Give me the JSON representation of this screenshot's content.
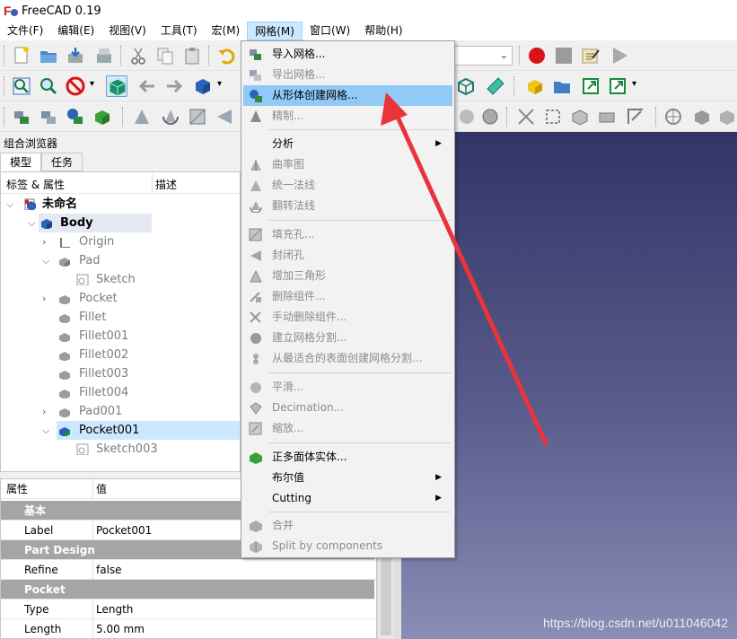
{
  "window": {
    "title": "FreeCAD 0.19"
  },
  "menubar": [
    {
      "label": "文件(F)"
    },
    {
      "label": "编辑(E)"
    },
    {
      "label": "视图(V)"
    },
    {
      "label": "工具(T)"
    },
    {
      "label": "宏(M)"
    },
    {
      "label": "网格(M)"
    },
    {
      "label": "窗口(W)"
    },
    {
      "label": "帮助(H)"
    }
  ],
  "combo_view": {
    "title": "组合浏览器",
    "tabs": [
      "模型",
      "任务"
    ],
    "tree_headers": {
      "label": "标签 & 属性",
      "desc": "描述"
    },
    "tree": [
      {
        "label": "未命名"
      },
      {
        "label": "Body"
      },
      {
        "label": "Origin"
      },
      {
        "label": "Pad"
      },
      {
        "label": "Sketch"
      },
      {
        "label": "Pocket"
      },
      {
        "label": "Fillet"
      },
      {
        "label": "Fillet001"
      },
      {
        "label": "Fillet002"
      },
      {
        "label": "Fillet003"
      },
      {
        "label": "Fillet004"
      },
      {
        "label": "Pad001"
      },
      {
        "label": "Pocket001"
      },
      {
        "label": "Sketch003"
      }
    ]
  },
  "properties": {
    "headers": {
      "prop": "属性",
      "value": "值"
    },
    "rows": [
      {
        "group": "基本"
      },
      {
        "name": "Label",
        "value": "Pocket001"
      },
      {
        "group": "Part Design"
      },
      {
        "name": "Refine",
        "value": "false"
      },
      {
        "group": "Pocket"
      },
      {
        "name": "Type",
        "value": "Length"
      },
      {
        "name": "Length",
        "value": "5.00 mm"
      }
    ]
  },
  "mesh_menu": {
    "items": [
      {
        "label": "导入网格..."
      },
      {
        "label": "导出网格..."
      },
      {
        "label": "从形体创建网格..."
      },
      {
        "label": "精制..."
      },
      {
        "label": "分析"
      },
      {
        "label": "曲率图"
      },
      {
        "label": "统一法线"
      },
      {
        "label": "翻转法线"
      },
      {
        "label": "填充孔..."
      },
      {
        "label": "封闭孔"
      },
      {
        "label": "增加三角形"
      },
      {
        "label": "删除组件..."
      },
      {
        "label": "手动删除组件..."
      },
      {
        "label": "建立网格分割..."
      },
      {
        "label": "从最适合的表面创建网格分割..."
      },
      {
        "label": "平滑..."
      },
      {
        "label": "Decimation..."
      },
      {
        "label": "缩放..."
      },
      {
        "label": "正多面体实体..."
      },
      {
        "label": "布尔值"
      },
      {
        "label": "Cutting"
      },
      {
        "label": "合并"
      },
      {
        "label": "Split by components"
      }
    ]
  },
  "watermark": "https://blog.csdn.net/u011046042",
  "colors": {
    "highlight": "#91c9f7",
    "annotation_arrow": "#e8343a",
    "view_top": "#333466",
    "view_bottom": "#8a8db5"
  }
}
